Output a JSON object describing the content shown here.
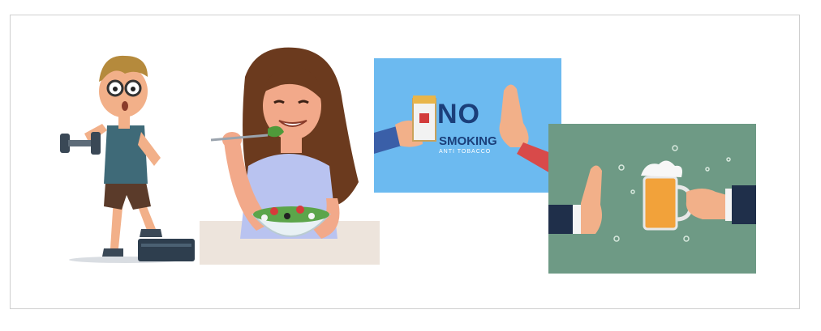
{
  "page": {
    "background": "#ffffff",
    "border_color": "#cfcfcf"
  },
  "images": [
    {
      "name": "exercise-illustration",
      "icon": "person-lifting-dumbbell-icon"
    },
    {
      "name": "healthy-eating-illustration",
      "icon": "woman-eating-salad-icon"
    },
    {
      "name": "no-smoking-poster",
      "icon": "refuse-cigarette-icon",
      "title": "NO",
      "subtitle": "SMOKING",
      "tagline": "ANTI TOBACCO",
      "colors": {
        "background": "#6cbaf0",
        "text": "#1b3f7a"
      }
    },
    {
      "name": "no-alcohol-illustration",
      "icon": "refuse-beer-icon",
      "colors": {
        "background": "#6e9a85"
      }
    }
  ]
}
